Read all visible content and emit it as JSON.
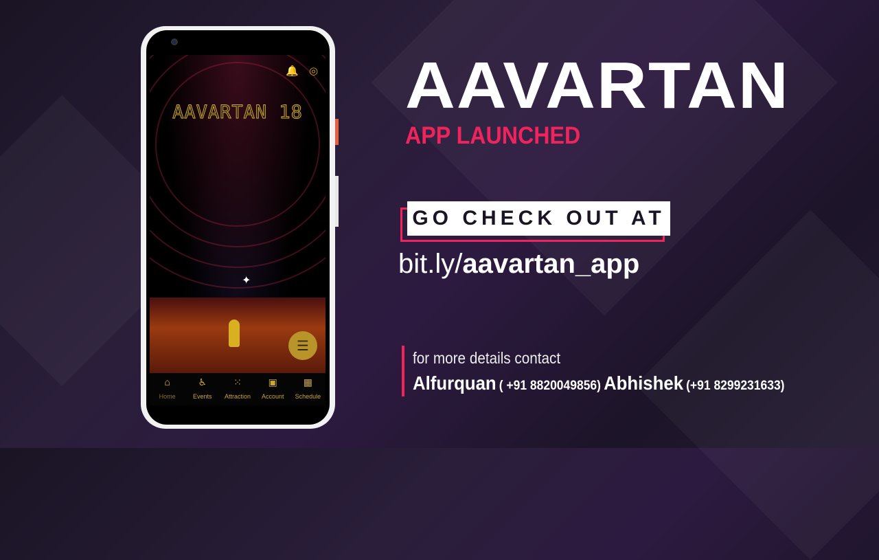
{
  "phone": {
    "app_title": "AAVARTAN 18",
    "icons": [
      "bell-icon",
      "locate-icon",
      "menu-fab-icon"
    ],
    "nav": [
      {
        "label": "Home",
        "icon": "home-icon"
      },
      {
        "label": "Events",
        "icon": "accessible-icon"
      },
      {
        "label": "Attraction",
        "icon": "grid-dots-icon"
      },
      {
        "label": "Account",
        "icon": "account-box-icon"
      },
      {
        "label": "Schedule",
        "icon": "calendar-icon"
      }
    ]
  },
  "headline": {
    "logo": "AAVARTAN",
    "subtitle": "APP LAUNCHED"
  },
  "cta": {
    "label": "GO CHECK OUT AT",
    "link_prefix": "bit.ly/",
    "link_path": "aavartan_app"
  },
  "contact": {
    "label": "for more details contact",
    "people": [
      {
        "name": "Alfurquan",
        "phone": "( +91 8820049856)"
      },
      {
        "name": "Abhishek",
        "phone": "(+91 8299231633)"
      }
    ]
  },
  "colors": {
    "accent": "#f0245c",
    "gold": "#c9a63a"
  }
}
